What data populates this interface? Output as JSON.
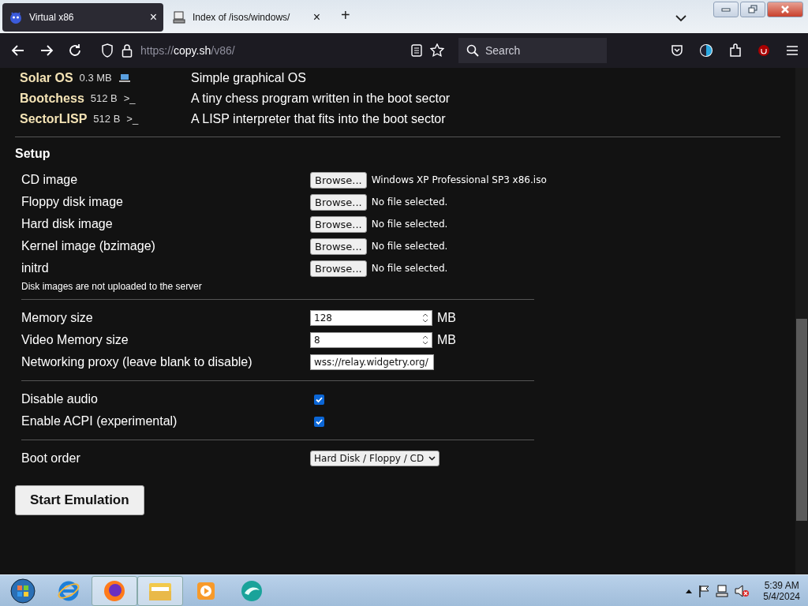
{
  "tabs": [
    {
      "title": "Virtual x86",
      "selected": true,
      "close": "×"
    },
    {
      "title": "Index of /isos/windows/",
      "selected": false,
      "close": "×"
    }
  ],
  "new_tab": "+",
  "toolbar": {
    "url_scheme": "https://",
    "url_host": "copy.sh",
    "url_path": "/v86/",
    "search_placeholder": "Search"
  },
  "os_list": [
    {
      "name": "Solar OS",
      "size": "0.3 MB",
      "kind": "graphical",
      "description": "Simple graphical OS"
    },
    {
      "name": "Bootchess",
      "size": "512 B",
      "kind": "text",
      "terminal": ">_",
      "description": "A tiny chess program written in the boot sector"
    },
    {
      "name": "SectorLISP",
      "size": "512 B",
      "kind": "text",
      "terminal": ">_",
      "description": "A LISP interpreter that fits into the boot sector"
    }
  ],
  "setup": {
    "title": "Setup",
    "files": [
      {
        "label": "CD image",
        "button": "Browse...",
        "file": "Windows XP Professional SP3 x86.iso"
      },
      {
        "label": "Floppy disk image",
        "button": "Browse...",
        "file": "No file selected."
      },
      {
        "label": "Hard disk image",
        "button": "Browse...",
        "file": "No file selected."
      },
      {
        "label": "Kernel image (bzimage)",
        "button": "Browse...",
        "file": "No file selected."
      },
      {
        "label": "initrd",
        "button": "Browse...",
        "file": "No file selected."
      }
    ],
    "note": "Disk images are not uploaded to the server",
    "fields": [
      {
        "label": "Memory size",
        "kind": "number",
        "value": "128",
        "unit": "MB"
      },
      {
        "label": "Video Memory size",
        "kind": "number",
        "value": "8",
        "unit": "MB"
      },
      {
        "label": "Networking proxy (leave blank to disable)",
        "kind": "text",
        "value": "wss://relay.widgetry.org/"
      }
    ],
    "checkboxes": [
      {
        "label": "Disable audio",
        "checked": true
      },
      {
        "label": "Enable ACPI (experimental)",
        "checked": true
      }
    ],
    "boot_order": {
      "label": "Boot order",
      "value": "Hard Disk / Floppy / CD"
    },
    "start_button": "Start Emulation"
  },
  "clock": {
    "time": "5:39 AM",
    "date": "5/4/2024"
  }
}
